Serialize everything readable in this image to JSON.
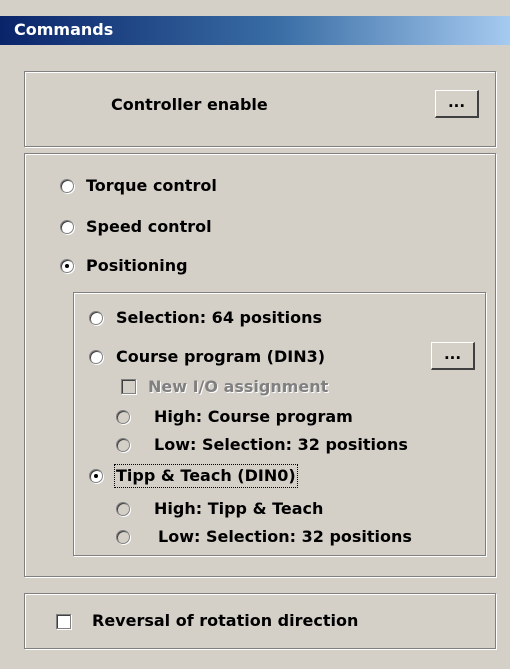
{
  "window": {
    "title": "Commands"
  },
  "controller": {
    "label": "Controller enable",
    "button_label": "..."
  },
  "mode": {
    "torque_label": "Torque control",
    "speed_label": "Speed control",
    "positioning_label": "Positioning",
    "selected": "Positioning"
  },
  "positioning": {
    "selection_label": "Selection: 64 positions",
    "course_label": "Course program (DIN3)",
    "course_button_label": "...",
    "new_io_label": "New I/O assignment",
    "course_high_label": "High: Course program",
    "course_low_label": "Low: Selection: 32 positions",
    "tipp_label": "Tipp & Teach (DIN0)",
    "tipp_high_label": "High: Tipp & Teach",
    "tipp_low_label": "Low: Selection: 32 positions",
    "selected": "Tipp & Teach (DIN0)"
  },
  "reversal": {
    "label": "Reversal of rotation direction",
    "checked": false
  }
}
